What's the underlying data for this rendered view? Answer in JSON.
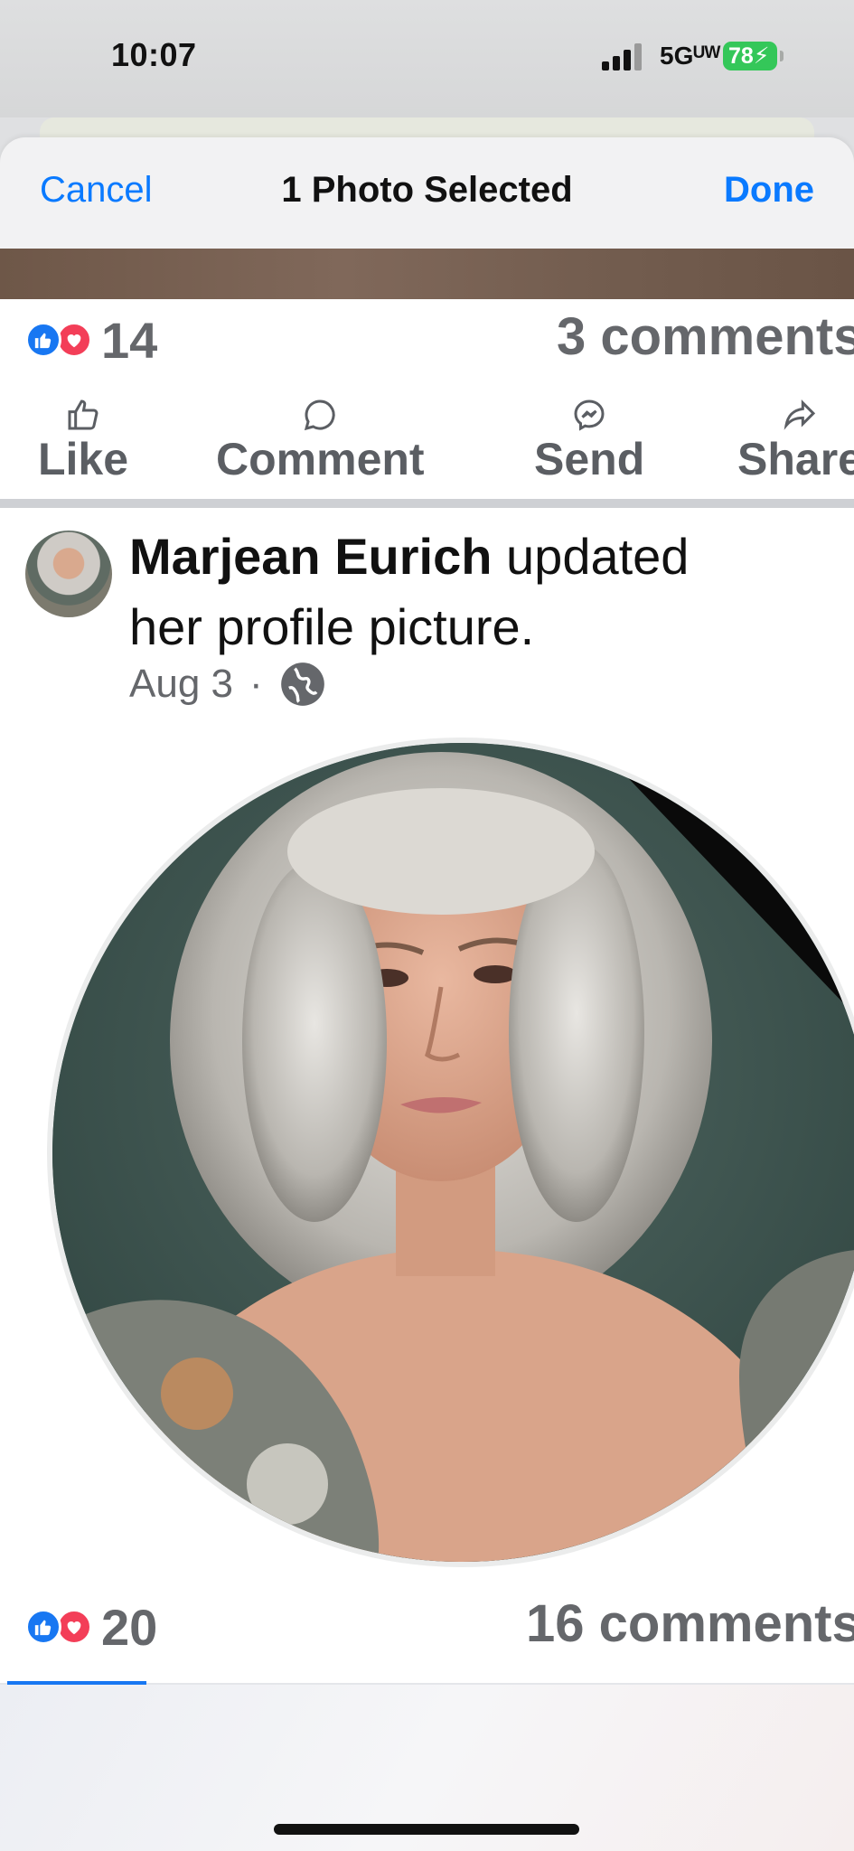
{
  "status_bar": {
    "time": "10:07",
    "network": "5Gᵁᵂ",
    "battery": "78"
  },
  "sheet": {
    "cancel_label": "Cancel",
    "title": "1 Photo Selected",
    "done_label": "Done",
    "accent_color": "#0a7aff"
  },
  "post_top": {
    "reaction_count": "14",
    "comments": "3 comments"
  },
  "actions": [
    {
      "label": "Like",
      "icon": "thumbs-up-icon"
    },
    {
      "label": "Comment",
      "icon": "comment-icon"
    },
    {
      "label": "Send",
      "icon": "messenger-icon"
    },
    {
      "label": "Share",
      "icon": "share-icon"
    }
  ],
  "post": {
    "author": "Marjean Eurich",
    "action_text": " updated",
    "action_line2": "her profile picture.",
    "date": "Aug 3",
    "separator": "·",
    "privacy_icon": "globe-icon"
  },
  "post_bottom": {
    "reaction_count": "20",
    "comments": "16 comments"
  },
  "colors": {
    "facebook_blue": "#1877f2",
    "love_red": "#f33e58",
    "secondary_text": "#65676b"
  }
}
